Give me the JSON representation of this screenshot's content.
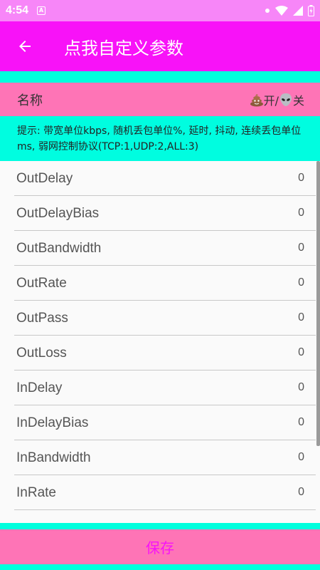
{
  "status_bar": {
    "time": "4:54",
    "app_icon_letter": "A"
  },
  "app_bar": {
    "title": "点我自定义参数"
  },
  "header": {
    "label": "名称",
    "on_text": "开/",
    "off_text": "关"
  },
  "hint": {
    "text": "提示: 带宽单位kbps, 随机丢包单位%, 延时, 抖动, 连续丢包单位ms, 弱网控制协议(TCP:1,UDP:2,ALL:3)"
  },
  "params": [
    {
      "name": "OutDelay",
      "value": "0"
    },
    {
      "name": "OutDelayBias",
      "value": "0"
    },
    {
      "name": "OutBandwidth",
      "value": "0"
    },
    {
      "name": "OutRate",
      "value": "0"
    },
    {
      "name": "OutPass",
      "value": "0"
    },
    {
      "name": "OutLoss",
      "value": "0"
    },
    {
      "name": "InDelay",
      "value": "0"
    },
    {
      "name": "InDelayBias",
      "value": "0"
    },
    {
      "name": "InBandwidth",
      "value": "0"
    },
    {
      "name": "InRate",
      "value": "0"
    }
  ],
  "save_button": {
    "label": "保存"
  },
  "colors": {
    "status_bar": "#f786f8",
    "app_bar": "#f812f8",
    "cyan": "#00ffdd",
    "pink": "#fe74b6"
  }
}
